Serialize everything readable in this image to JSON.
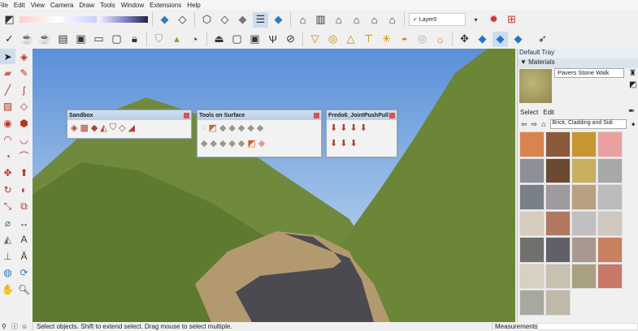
{
  "menu": [
    "File",
    "Edit",
    "View",
    "Camera",
    "Draw",
    "Tools",
    "Window",
    "Extensions",
    "Help"
  ],
  "toolbar": {
    "layer": "✓ Layer0"
  },
  "toolbar_icons_row1": [
    "shadows-icon",
    "time-slider-icon",
    "date-slider-icon",
    "xray-icon",
    "wireframe-icon",
    "hidden-line-icon",
    "shaded-icon",
    "textured-icon",
    "monochrome-icon",
    "iso-view-icon",
    "front-view-icon",
    "top-view-icon",
    "right-view-icon",
    "back-view-icon",
    "left-view-icon",
    "bottom-view-icon"
  ],
  "sandbox": {
    "title": "Sandbox"
  },
  "tos": {
    "title": "Tools on Surface"
  },
  "fredo": {
    "title": "Fredo6_JointPushPull"
  },
  "tray": {
    "title": "Default Tray",
    "panel": "▼ Materials",
    "material_name": "Pavers Stone Walk",
    "tab_select": "Select",
    "tab_edit": "Edit",
    "collection": "Brick, Cladding and Sidi"
  },
  "swatches": [
    "#d9834f",
    "#8a5a3a",
    "#c8962e",
    "#e8a0a0",
    "#8c8f98",
    "#6a4a30",
    "#c9b060",
    "#a8a8a8",
    "#7a8088",
    "#9e9aa0",
    "#b8a080",
    "#bcbcbc",
    "#d8ccc0",
    "#b07860",
    "#c0c0c0",
    "#d0c8c0",
    "#70706c",
    "#606068",
    "#a89890",
    "#c88060",
    "#d8d0c0",
    "#c8c0b0",
    "#a8a080",
    "#c87868",
    "#a8a8a0",
    "#c0b8a8"
  ],
  "status": {
    "text": "Select objects. Shift to extend select. Drag mouse to select multiple.",
    "measurements": "Measurements"
  },
  "colors": {
    "sky_top": "#5a8fd8",
    "sky_bottom": "#cfe4f3",
    "hill": "#6f8a3c",
    "road": "#4a4a50"
  }
}
